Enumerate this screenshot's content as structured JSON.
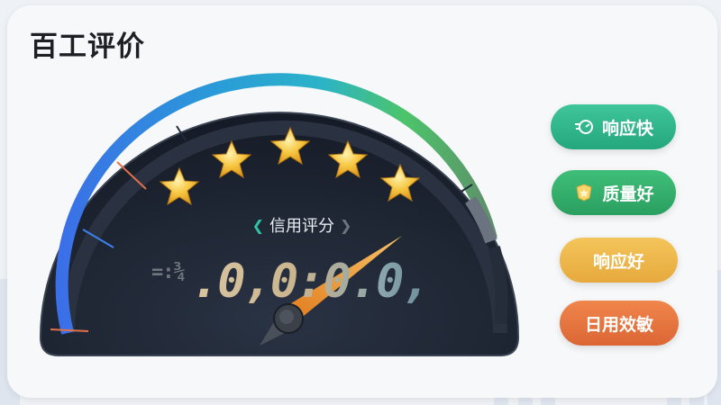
{
  "page": {
    "title": "百工评价"
  },
  "gauge": {
    "label": "信用评分",
    "score_prefix": "=:¾",
    "score_text": ".0,0:0.0,",
    "stars_filled": 5,
    "stars_total": 5
  },
  "tags": [
    {
      "label": "响应快",
      "icon": "speed-icon",
      "color": "#2db386"
    },
    {
      "label": "质量好",
      "icon": "badge-icon",
      "color": "#34ad6c"
    },
    {
      "label": "响应好",
      "icon": "",
      "color": "#ecb64a"
    },
    {
      "label": "日用效敏",
      "icon": "",
      "color": "#e6743e"
    }
  ],
  "colors": {
    "accent_blue": "#3b82f0",
    "accent_cyan": "#2bb3c9",
    "accent_green": "#4cc46a",
    "needle": "#f29a2e",
    "gauge_bg": "#1b2230"
  }
}
